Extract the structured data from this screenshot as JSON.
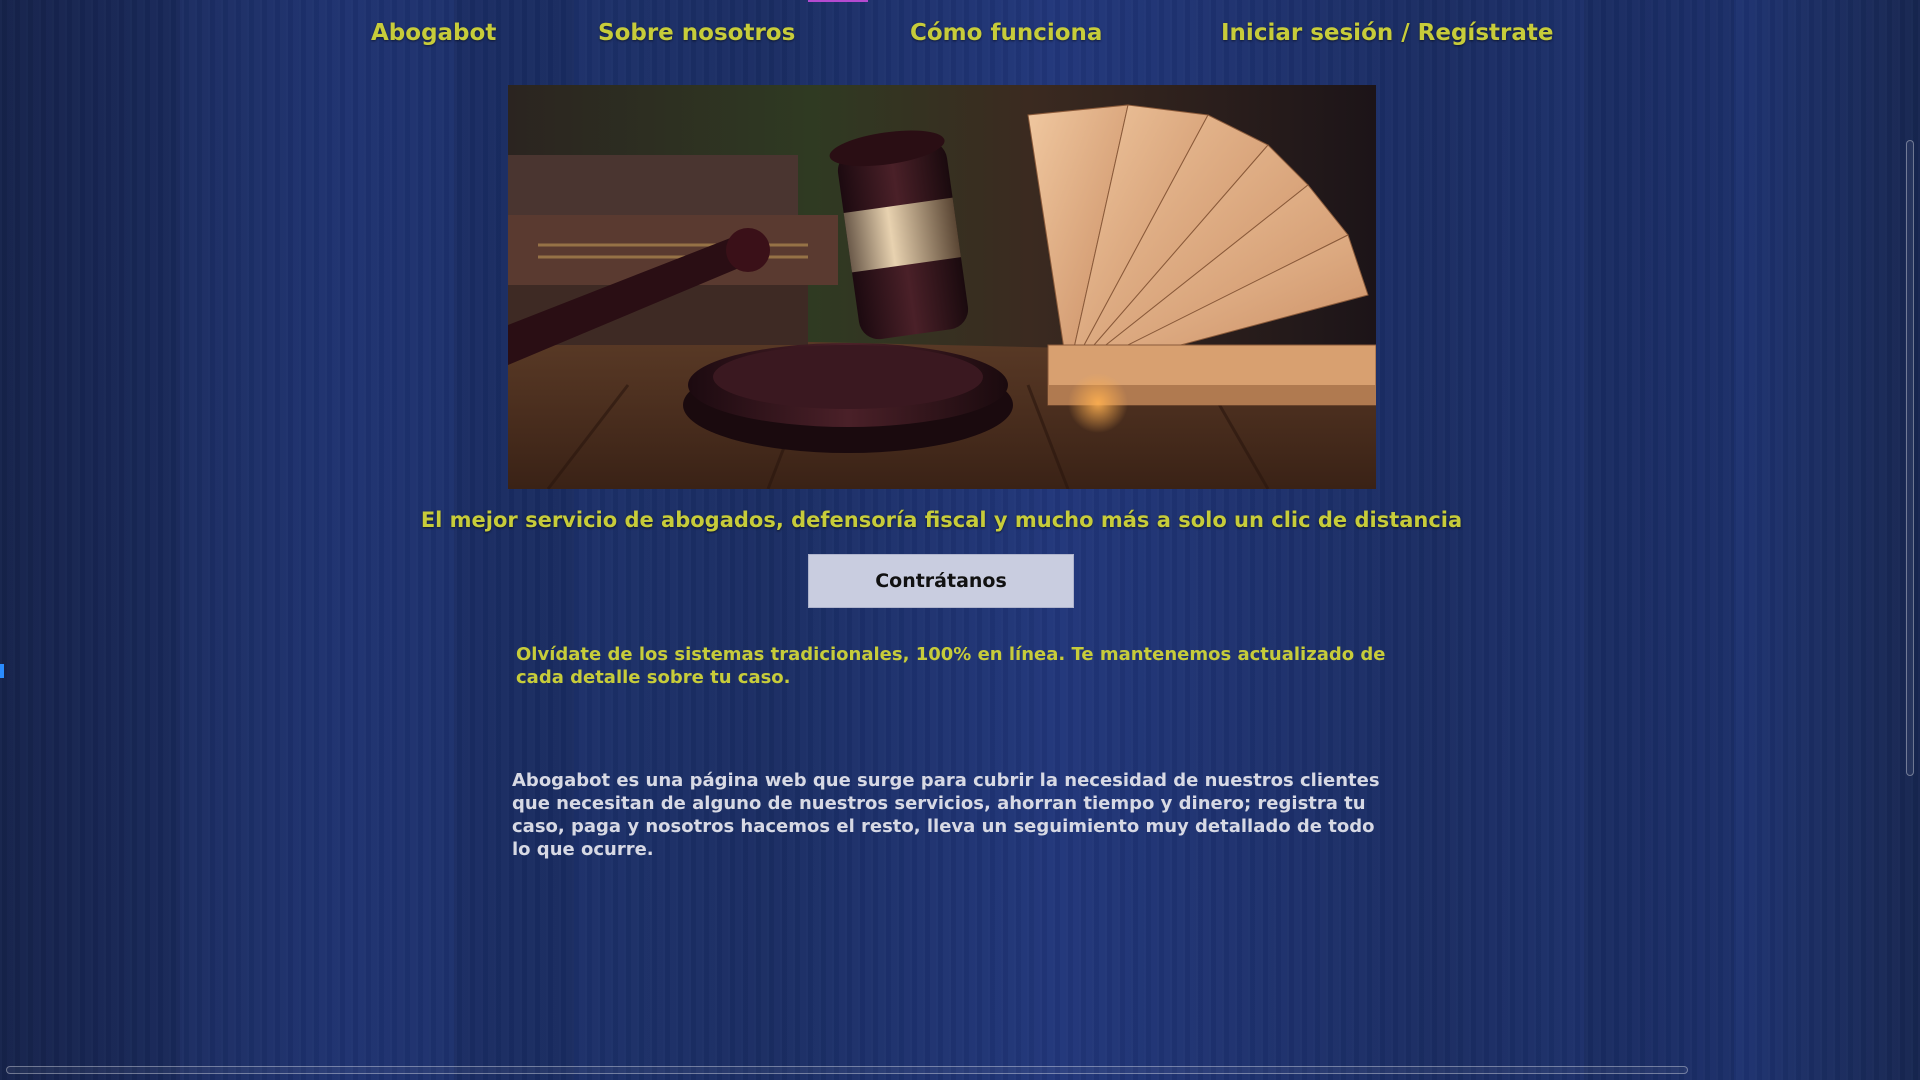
{
  "nav": {
    "brand": "Abogabot",
    "about": "Sobre nosotros",
    "how": "Cómo funciona",
    "login": "Iniciar sesión / Regístrate"
  },
  "hero": {
    "image": "gavel-and-book-photo"
  },
  "tagline": "El mejor servicio de abogados, defensoría fiscal y mucho más a solo un clic de distancia",
  "cta_label": "Contrátanos",
  "intro_text": "Olvídate de los sistemas tradicionales, 100% en línea. Te mantenemos actualizado de cada detalle sobre tu caso.",
  "about_text": "Abogabot es una página web que surge para cubrir la necesidad de nuestros clientes que necesitan de alguno de nuestros servicios, ahorran tiempo y dinero; registra tu caso, paga y nosotros hacemos el resto, lleva un seguimiento muy detallado de todo lo que ocurre.",
  "colors": {
    "accent_yellow": "#c7cc3a",
    "background_blue": "#1b2c5e",
    "button_bg": "#c9cde0",
    "body_text": "#d7d9e4"
  }
}
